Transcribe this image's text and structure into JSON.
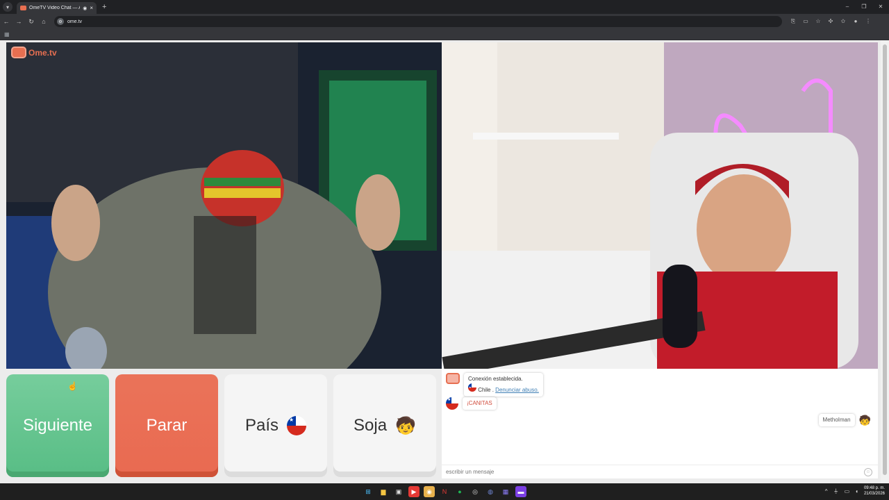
{
  "browser": {
    "tab_title": "OmeTV Video Chat — Altr",
    "url": "ome.tv",
    "new_tab": "+",
    "close": "×"
  },
  "site": {
    "logo_text": "Ome.tv"
  },
  "buttons": {
    "next": "Siguiente",
    "stop": "Parar",
    "country": "País",
    "gender": "Soja"
  },
  "chat": {
    "system_line1": "Conexión establecida.",
    "system_country": "Chile",
    "system_separator": ".",
    "report_link": "Denunciar abuso.",
    "stranger_message": "¡CANITAS",
    "self_name": "MethoIman",
    "input_placeholder": "escribir un mensaje"
  },
  "taskbar": {
    "time": "09:48 p. m.",
    "date": "21/03/2026"
  },
  "colors": {
    "next_green": "#6cc793",
    "stop_red": "#e96a51",
    "brand_orange": "#e76f51"
  }
}
